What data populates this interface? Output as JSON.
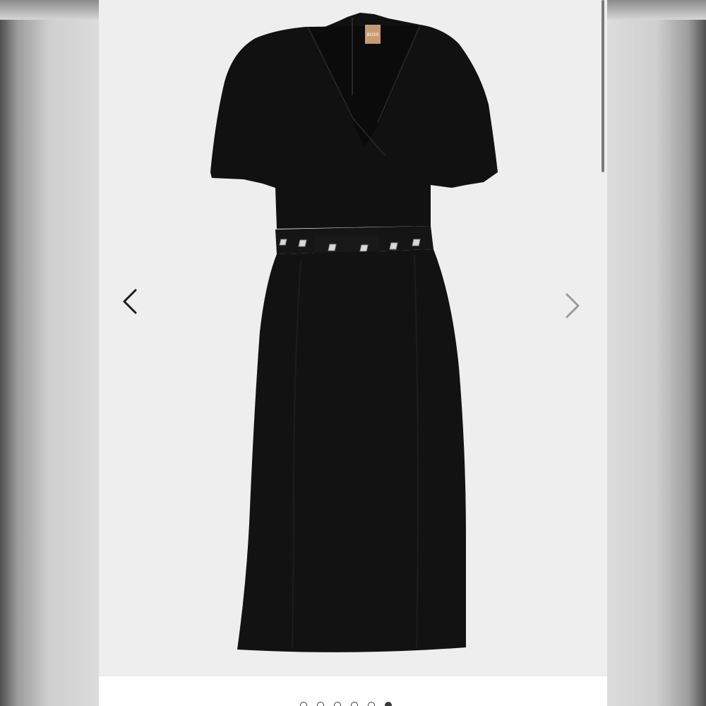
{
  "gallery": {
    "brand_label_text": "BOSS",
    "favorite_icon": "heart-outline-icon",
    "prev_icon": "chevron-left-icon",
    "next_icon": "chevron-right-icon",
    "slide_count": 6,
    "active_slide_index": 6,
    "colors": {
      "background": "#eeeeee",
      "dress": "#121212",
      "brand_tag": "#c89a72",
      "prev_arrow": "#1a1a1a",
      "next_arrow": "#9a9a9a",
      "heart": "#6a6a6a"
    }
  }
}
